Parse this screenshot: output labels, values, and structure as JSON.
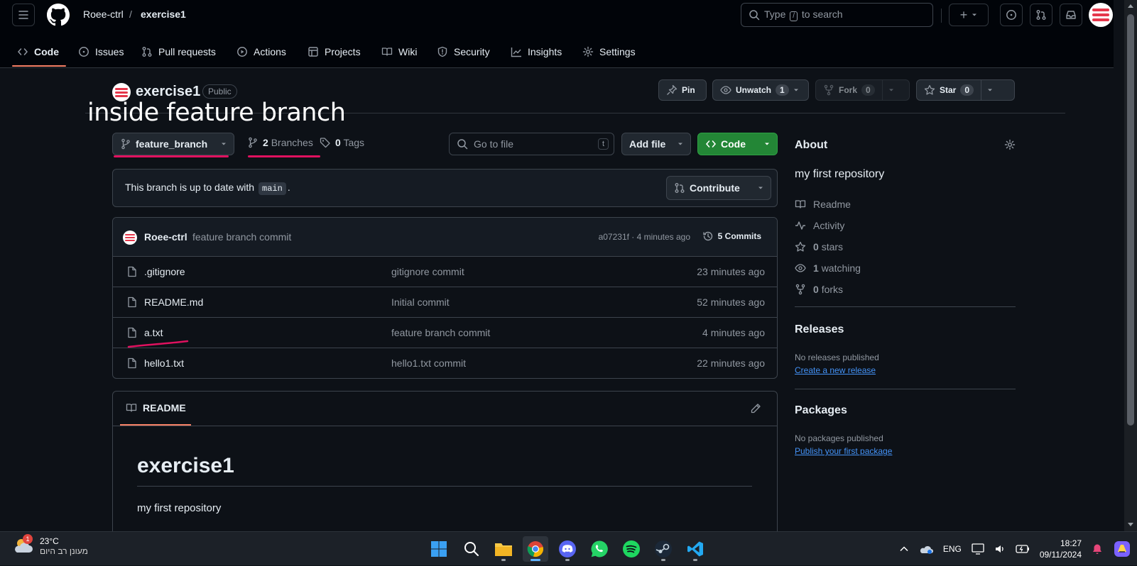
{
  "header": {
    "owner": "Roee-ctrl",
    "separator": "/",
    "repo": "exercise1",
    "search_before": "Type",
    "search_key": "/",
    "search_after": "to search",
    "plus": "+"
  },
  "tabs": [
    {
      "label": "Code",
      "icon": "code-icon",
      "selected": true
    },
    {
      "label": "Issues",
      "icon": "issue-icon"
    },
    {
      "label": "Pull requests",
      "icon": "pull-request-icon"
    },
    {
      "label": "Actions",
      "icon": "play-icon"
    },
    {
      "label": "Projects",
      "icon": "table-icon"
    },
    {
      "label": "Wiki",
      "icon": "book-icon"
    },
    {
      "label": "Security",
      "icon": "shield-icon"
    },
    {
      "label": "Insights",
      "icon": "graph-icon"
    },
    {
      "label": "Settings",
      "icon": "gear-icon"
    }
  ],
  "repo": {
    "name": "exercise1",
    "visibility": "Public",
    "annotation": "inside feature branch",
    "pin_label": "Pin",
    "unwatch_label": "Unwatch",
    "watch_count": "1",
    "fork_label": "Fork",
    "fork_count": "0",
    "star_label": "Star",
    "star_count": "0"
  },
  "branchbar": {
    "branch": "feature_branch",
    "branches_count": "2",
    "branches_label": "Branches",
    "tags_count": "0",
    "tags_label": "Tags",
    "goto_placeholder": "Go to file",
    "goto_key": "t",
    "add_file": "Add file",
    "code": "Code"
  },
  "status": {
    "text_before": "This branch is up to date with",
    "base": "main",
    "text_after": ".",
    "contribute": "Contribute"
  },
  "latest_commit": {
    "author": "Roee-ctrl",
    "message": "feature branch commit",
    "meta": "a07231f · 4 minutes ago",
    "commits": "5 Commits"
  },
  "files": [
    {
      "name": ".gitignore",
      "commit": "gitignore commit",
      "age": "23 minutes ago"
    },
    {
      "name": "README.md",
      "commit": "Initial commit",
      "age": "52 minutes ago"
    },
    {
      "name": "a.txt",
      "commit": "feature branch commit",
      "age": "4 minutes ago"
    },
    {
      "name": "hello1.txt",
      "commit": "hello1.txt commit",
      "age": "22 minutes ago"
    }
  ],
  "readme": {
    "tab": "README",
    "title": "exercise1",
    "body": "my first repository"
  },
  "about": {
    "title": "About",
    "description": "my first repository",
    "items": [
      {
        "icon": "book-icon",
        "label": "Readme"
      },
      {
        "icon": "pulse-icon",
        "label": "Activity"
      },
      {
        "icon": "star-icon",
        "count": "0",
        "label": "stars"
      },
      {
        "icon": "eye-icon",
        "count": "1",
        "label": "watching"
      },
      {
        "icon": "fork-icon",
        "count": "0",
        "label": "forks"
      }
    ]
  },
  "releases": {
    "title": "Releases",
    "empty": "No releases published",
    "link": "Create a new release"
  },
  "packages": {
    "title": "Packages",
    "empty": "No packages published",
    "link": "Publish your first package"
  },
  "taskbar": {
    "weather_temp": "23°C",
    "weather_desc": "מעונן רב היום",
    "weather_badge": "1",
    "lang": "ENG",
    "time": "18:27",
    "date": "09/11/2024"
  },
  "colors": {
    "accent_green": "#238636",
    "tab_underline": "#f78166",
    "link": "#4493f8",
    "annotation_marker": "#e0115f"
  }
}
